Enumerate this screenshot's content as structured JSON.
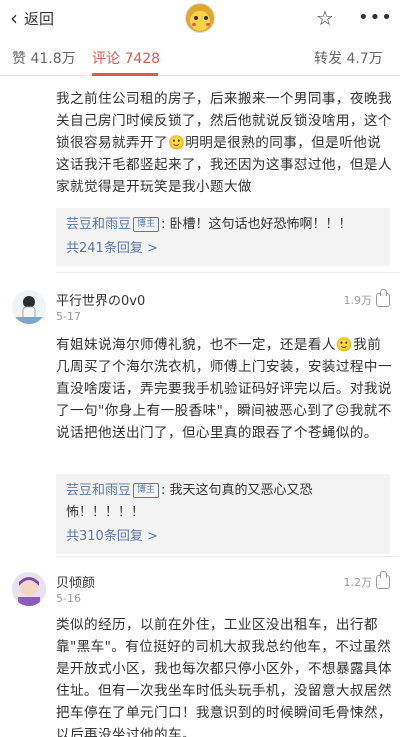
{
  "topbar": {
    "back_label": "返回",
    "back_icon": "chevron-left-icon",
    "star_icon": "star-outline-icon",
    "more_icon": "more-dots-icon"
  },
  "tabs": {
    "likes": "赞 41.8万",
    "comments": "评论 7428",
    "reposts": "转发 4.7万",
    "active_color": "#e4574b"
  },
  "comment0": {
    "text": "我之前住公司租的房子，后来搬来一个男同事，夜晚我关自己房门时候反锁了，然后他就说反锁没啥用，这个锁很容易就弄开了🙂明明是很熟的同事，但是听他说这话我汗毛都竖起来了，我还因为这事怼过他，但是人家就觉得是开玩笑是我小题大做",
    "reply": {
      "user": "芸豆和雨豆",
      "badge": "博主",
      "text": ": 卧槽！这句话也好恐怖啊！！！",
      "more": "共241条回复 >"
    }
  },
  "comment1": {
    "name": "平行世界の0v0",
    "date": "5-17",
    "likes": "1.9万",
    "text": "有姐妹说海尔师傅礼貌，也不一定，还是看人🙂我前几周买了个海尔洗衣机，师傅上门安装，安装过程中一直没啥废话，弄完要我手机验证码好评完以后。对我说了一句\"你身上有一股香味\"，瞬间被恶心到了😖我就不说话把他送出门了，但心里真的跟吞了个苍蝇似的。",
    "reply": {
      "user": "芸豆和雨豆",
      "badge": "博主",
      "text": ": 我天这句真的又恶心又恐怖！！！！！",
      "more": "共310条回复 >"
    }
  },
  "comment2": {
    "name": "贝倾颜",
    "date": "5-16",
    "likes": "1.2万",
    "text": "类似的经历，以前在外住，工业区没出租车，出行都靠\"黑车\"。有位挺好的司机大叔我总约他车，不过虽然是开放式小区，我也每次都只停小区外，不想暴露具体住址。但有一次我坐车时低头玩手机，没留意大叔居然把车停在了单元门口！我意识到的时候瞬间毛骨悚然，以后再没坐过他的车。"
  }
}
